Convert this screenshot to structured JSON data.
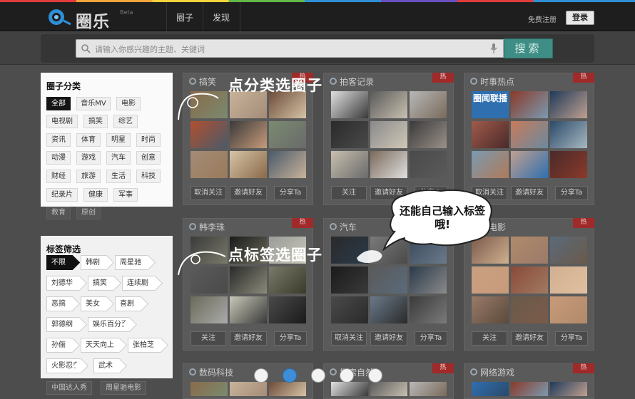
{
  "header": {
    "logo_text": "圈乐",
    "logo_badge": "Beta",
    "nav": [
      "圈子",
      "发现"
    ],
    "register_label": "免费注册",
    "login_label": "登录"
  },
  "search": {
    "placeholder": "请输入你感兴趣的主题、关键词",
    "button_label": "搜索"
  },
  "categories": {
    "title": "圈子分类",
    "items": [
      "全部",
      "音乐MV",
      "电影",
      "电视剧",
      "搞笑",
      "综艺",
      "资讯",
      "体育",
      "明星",
      "时尚",
      "动漫",
      "游戏",
      "汽车",
      "创意",
      "财经",
      "旅游",
      "生活",
      "科技",
      "纪录片",
      "健康",
      "军事"
    ],
    "selected": "全部",
    "overflow": [
      "教育",
      "原创"
    ]
  },
  "tags": {
    "title": "标签筛选",
    "items": [
      "不限",
      "韩剧",
      "周星驰",
      "刘德华",
      "搞笑",
      "连续剧",
      "恶搞",
      "美女",
      "喜剧",
      "郭德纲",
      "娱乐百分百",
      "孙俪",
      "天天向上",
      "张柏芝",
      "火影忍者",
      "武术"
    ],
    "selected": "不限",
    "overflow": [
      "中国达人秀",
      "周星驰电影"
    ]
  },
  "cards": [
    {
      "title": "搞笑",
      "hot": true,
      "actions": [
        "取消关注",
        "邀请好友",
        "分享Ta"
      ]
    },
    {
      "title": "拍客记录",
      "hot": true,
      "actions": [
        "关注",
        "邀请好友",
        "分享Ta"
      ]
    },
    {
      "title": "时事热点",
      "hot": true,
      "actions": [
        "取消关注",
        "邀请好友",
        "分享Ta"
      ]
    },
    {
      "title": "韩李珠",
      "hot": true,
      "actions": [
        "关注",
        "邀请好友",
        "分享Ta"
      ]
    },
    {
      "title": "汽车",
      "hot": true,
      "actions": [
        "取消关注",
        "邀请好友",
        "分享Ta"
      ]
    },
    {
      "title": "微电影",
      "hot": true,
      "actions": [
        "关注",
        "邀请好友",
        "分享Ta"
      ]
    },
    {
      "title": "数码科技",
      "hot": false,
      "actions": []
    },
    {
      "title": "探索自然",
      "hot": true,
      "actions": []
    },
    {
      "title": "网络游戏",
      "hot": true,
      "actions": []
    }
  ],
  "hot_label": "热",
  "thumb_text": {
    "news_logo": "圈闻联播"
  },
  "annotations": {
    "category_hint": "点分类选圈子",
    "tag_hint": "点标签选圈子",
    "bubble_text": "还能自己输入标签哦!"
  },
  "pager": {
    "count": 5,
    "active": 2
  },
  "colors": {
    "accent": "#3f8e86",
    "hot": "#a02a2a",
    "pager_active": "#3d8ed6"
  }
}
